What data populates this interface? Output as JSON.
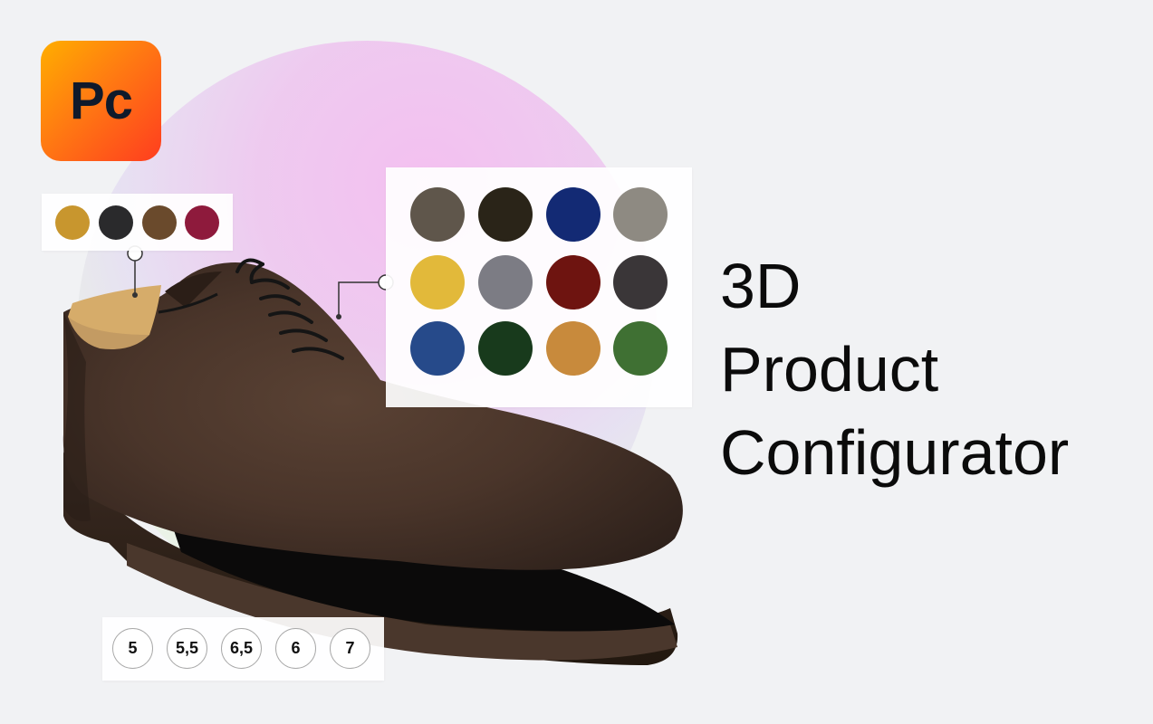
{
  "logo": {
    "text": "Pc",
    "gradient": [
      "#ffae00",
      "#ff3d1f"
    ]
  },
  "title": {
    "lines": [
      "3D",
      "Product",
      "Configurator"
    ]
  },
  "lining_swatches": [
    {
      "name": "tan-leather",
      "color": "#c8962e"
    },
    {
      "name": "black-leather",
      "color": "#2a2a2c"
    },
    {
      "name": "brown-leather",
      "color": "#6a4a2c"
    },
    {
      "name": "burgundy-leather",
      "color": "#8e1a3c"
    }
  ],
  "material_swatches": [
    {
      "name": "taupe-suede",
      "color": "#5f564b"
    },
    {
      "name": "dark-brown-suede",
      "color": "#2a2418"
    },
    {
      "name": "navy-suede",
      "color": "#132a74"
    },
    {
      "name": "grey-suede",
      "color": "#8e8a82"
    },
    {
      "name": "yellow-suede",
      "color": "#e2b93a"
    },
    {
      "name": "grey-croc",
      "color": "#7c7c84"
    },
    {
      "name": "red-suede",
      "color": "#6e1410"
    },
    {
      "name": "charcoal-croc",
      "color": "#3a3638"
    },
    {
      "name": "blue-croc",
      "color": "#264a8a"
    },
    {
      "name": "green-croc",
      "color": "#183a1c"
    },
    {
      "name": "tan-croc",
      "color": "#c88a3c"
    },
    {
      "name": "green-suede",
      "color": "#3f7033"
    }
  ],
  "sizes": [
    "5",
    "5,5",
    "6,5",
    "6",
    "7"
  ]
}
